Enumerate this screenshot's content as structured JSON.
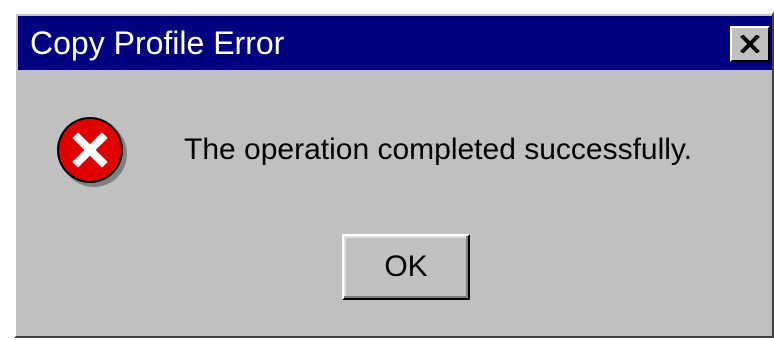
{
  "dialog": {
    "title": "Copy Profile Error",
    "close_icon": "close-icon",
    "error_icon": "error-icon",
    "message": "The operation completed successfully.",
    "ok_label": "OK"
  },
  "colors": {
    "titlebar": "#000080",
    "face": "#c0c0c0",
    "error_red": "#e00000"
  }
}
